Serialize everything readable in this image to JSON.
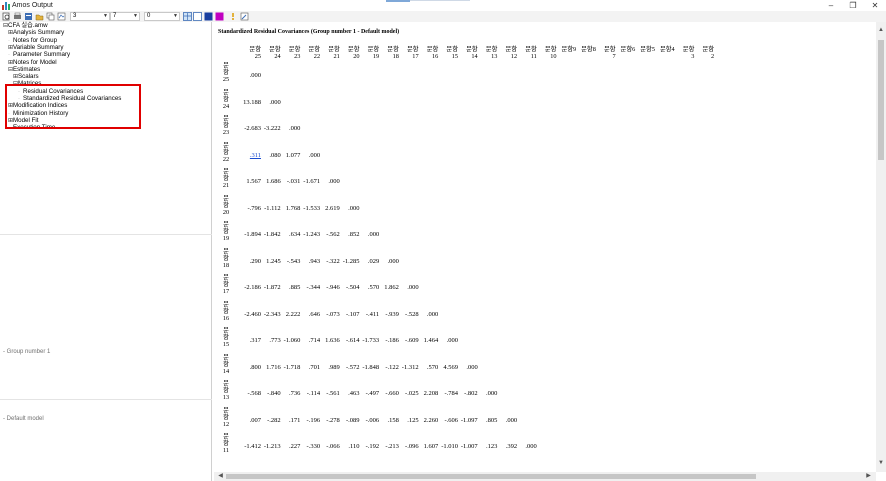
{
  "window": {
    "title": "Amos Output",
    "minimize": "–",
    "maximize": "❐",
    "close": "✕"
  },
  "toolbar": {
    "decimals_value": "3",
    "width_value": "7",
    "column_value": "0"
  },
  "tree": {
    "items": [
      {
        "label": "CFA 실습.amw",
        "glyph": "⊟"
      },
      {
        "label": "Analysis Summary",
        "glyph": "⊞"
      },
      {
        "label": "Notes for Group",
        "glyph": ""
      },
      {
        "label": "Variable Summary",
        "glyph": "⊞"
      },
      {
        "label": "Parameter Summary",
        "glyph": ""
      },
      {
        "label": "Notes for Model",
        "glyph": "⊞"
      },
      {
        "label": "Estimates",
        "glyph": "⊟"
      },
      {
        "label": "Scalars",
        "glyph": "⊞"
      },
      {
        "label": "Matrices",
        "glyph": "⊟"
      },
      {
        "label": "Residual Covariances",
        "glyph": ""
      },
      {
        "label": "Standardized Residual Covariances",
        "glyph": ""
      },
      {
        "label": "Modification Indices",
        "glyph": "⊞"
      },
      {
        "label": "Minimization History",
        "glyph": ""
      },
      {
        "label": "Model Fit",
        "glyph": "⊞"
      },
      {
        "label": "Execution Time",
        "glyph": ""
      }
    ],
    "group_label": "- Group number 1",
    "model_label": "- Default model"
  },
  "main": {
    "heading": "Standardized Residual Covariances (Group number 1 - Default model)",
    "columns": [
      [
        "문항",
        "25"
      ],
      [
        "문항",
        "24"
      ],
      [
        "문항",
        "23"
      ],
      [
        "문항",
        "22"
      ],
      [
        "문항",
        "21"
      ],
      [
        "문항",
        "20"
      ],
      [
        "문항",
        "19"
      ],
      [
        "문항",
        "18"
      ],
      [
        "문항",
        "17"
      ],
      [
        "문항",
        "16"
      ],
      [
        "문항",
        "15"
      ],
      [
        "문항",
        "14"
      ],
      [
        "문항",
        "13"
      ],
      [
        "문항",
        "12"
      ],
      [
        "문항",
        "11"
      ],
      [
        "문항",
        "10"
      ],
      [
        "문항9",
        ""
      ],
      [
        "문항8",
        ""
      ],
      [
        "문항",
        "7"
      ],
      [
        "문항6",
        ""
      ],
      [
        "문항5",
        ""
      ],
      [
        "문항4",
        ""
      ],
      [
        "문항",
        "3"
      ],
      [
        "문항",
        "2"
      ]
    ],
    "rows": [
      {
        "label": "문항25",
        "values": [
          ".000"
        ]
      },
      {
        "label": "문항24",
        "values": [
          "13.188",
          ".000"
        ]
      },
      {
        "label": "문항23",
        "values": [
          "-2.683",
          "-3.222",
          ".000"
        ]
      },
      {
        "label": "문항22",
        "values": [
          ".311",
          ".080",
          "1.077",
          ".000"
        ]
      },
      {
        "label": "문항21",
        "values": [
          "1.567",
          "1.686",
          "-.031",
          "-1.671",
          ".000"
        ]
      },
      {
        "label": "문항20",
        "values": [
          "-.796",
          "-1.112",
          "1.768",
          "-1.533",
          "2.619",
          ".000"
        ]
      },
      {
        "label": "문항19",
        "values": [
          "-1.894",
          "-1.842",
          ".634",
          "-1.243",
          "-.562",
          ".852",
          ".000"
        ]
      },
      {
        "label": "문항18",
        "values": [
          ".290",
          "1.245",
          "-.543",
          ".943",
          "-.322",
          "-1.285",
          ".029",
          ".000"
        ]
      },
      {
        "label": "문항17",
        "values": [
          "-2.186",
          "-1.872",
          ".885",
          "-.344",
          "-.946",
          "-.504",
          ".570",
          "1.862",
          ".000"
        ]
      },
      {
        "label": "문항16",
        "values": [
          "-2.460",
          "-2.343",
          "2.222",
          ".646",
          "-.073",
          "-.107",
          "-.411",
          "-.939",
          "-.528",
          ".000"
        ]
      },
      {
        "label": "문항15",
        "values": [
          ".317",
          ".773",
          "-1.060",
          ".714",
          "1.636",
          "-.614",
          "-1.733",
          "-.186",
          "-.609",
          "1.464",
          ".000"
        ]
      },
      {
        "label": "문항14",
        "values": [
          ".800",
          "1.716",
          "-1.718",
          ".701",
          ".989",
          "-.572",
          "-1.848",
          "-.122",
          "-1.312",
          ".570",
          "4.569",
          ".000"
        ]
      },
      {
        "label": "문항13",
        "values": [
          "-.568",
          "-.840",
          ".736",
          "-.114",
          "-.561",
          ".463",
          "-.497",
          "-.660",
          "-.025",
          "2.208",
          "-.784",
          "-.802",
          ".000"
        ]
      },
      {
        "label": "문항12",
        "values": [
          ".007",
          "-.282",
          ".171",
          "-.196",
          "-.278",
          "-.089",
          "-.006",
          ".158",
          ".125",
          "2.260",
          "-.606",
          "-1.097",
          ".805",
          ".000"
        ]
      },
      {
        "label": "문항11",
        "values": [
          "-1.412",
          "-1.213",
          ".227",
          "-.330",
          "-.066",
          ".110",
          "-.192",
          "-.213",
          "-.096",
          "1.607",
          "-1.010",
          "-1.007",
          ".123",
          ".392",
          ".000"
        ]
      }
    ]
  }
}
